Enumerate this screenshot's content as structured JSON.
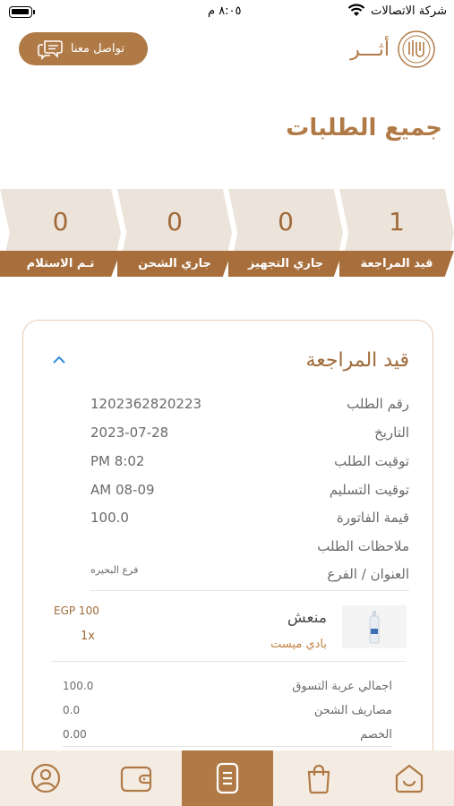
{
  "status_bar": {
    "carrier": "شركة الاتصالات",
    "time": "٨:٠٥ م"
  },
  "header": {
    "contact_label": "تواصل معنا",
    "logo_text": "أثـــر"
  },
  "page_title": "جميع الطلبات",
  "status_tiles": [
    {
      "label": "قيد المراجعة",
      "count": "1"
    },
    {
      "label": "جاري التجهيز",
      "count": "0"
    },
    {
      "label": "جاري الشحن",
      "count": "0"
    },
    {
      "label": "تـم الاستلام",
      "count": "0"
    }
  ],
  "order": {
    "status_title": "قيد المراجعة",
    "fields": [
      {
        "key": "رقم الطلب",
        "value": "1202362820223"
      },
      {
        "key": "التاريخ",
        "value": "2023-07-28"
      },
      {
        "key": "توقيت الطلب",
        "value": "PM 8:02"
      },
      {
        "key": "توقيت التسليم",
        "value": "AM 08-09"
      },
      {
        "key": "قيمة الفاتورة",
        "value": "100.0"
      },
      {
        "key": "ملاحظات الطلب",
        "value": ""
      }
    ],
    "address": {
      "key": "العنوان / الفرع",
      "value": "فرع البحيره"
    },
    "item": {
      "name": "منعش",
      "brand": "بادي ميست",
      "price": "EGP 100",
      "qty": "1x"
    },
    "totals": [
      {
        "key": "اجمالي عربة التسوق",
        "value": "100.0"
      },
      {
        "key": "مصاريف الشحن",
        "value": "0.0"
      },
      {
        "key": "الخصم",
        "value": "0.00"
      }
    ]
  },
  "bottom_nav": [
    {
      "name": "home",
      "icon": "home-smile-icon"
    },
    {
      "name": "bag",
      "icon": "shopping-bag-icon"
    },
    {
      "name": "orders",
      "icon": "document-list-icon",
      "active": true
    },
    {
      "name": "wallet",
      "icon": "wallet-icon"
    },
    {
      "name": "profile",
      "icon": "user-circle-icon"
    }
  ],
  "colors": {
    "accent": "#b07a46",
    "tile_bg": "#ece4da",
    "nav_bg": "#f4ece2"
  }
}
